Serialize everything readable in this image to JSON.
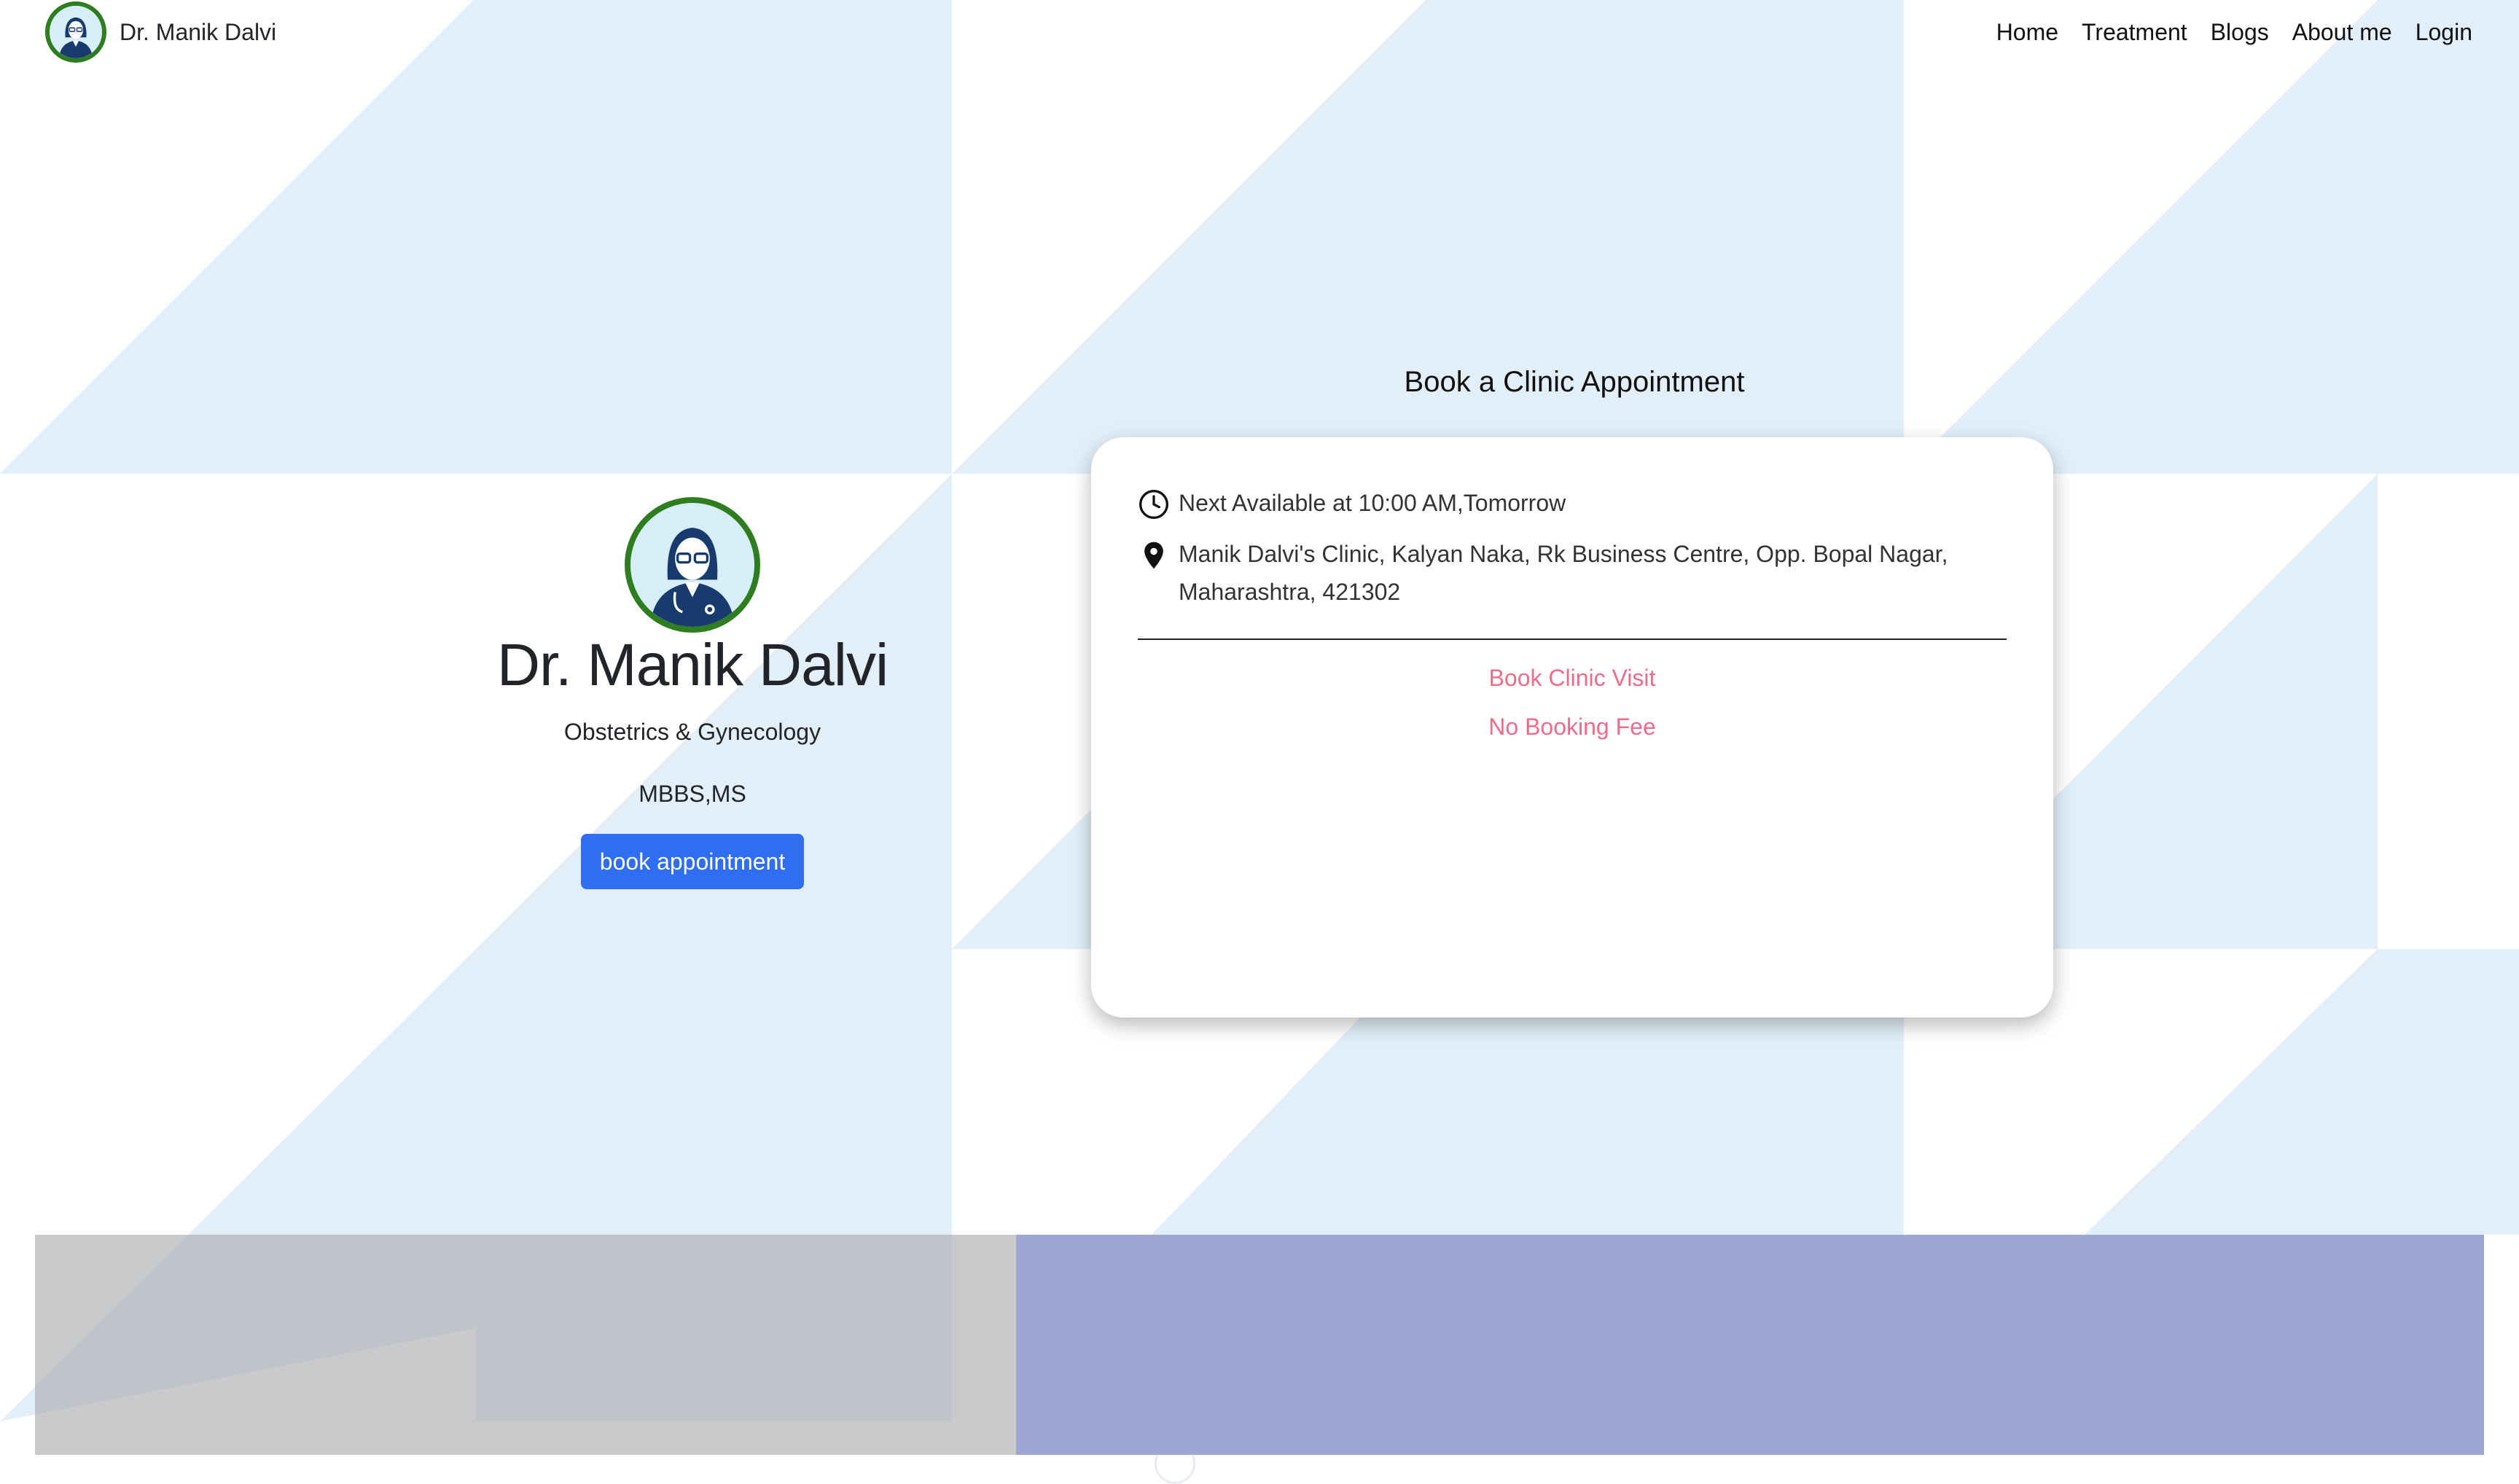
{
  "colors": {
    "bg_triangle": "#e2eff9",
    "avatar_ring": "#2e7d1f",
    "primary_button": "#2f6ef2",
    "pink_link": "#ee6b8a",
    "bottom_purple": "#9ea7d4"
  },
  "navbar": {
    "brand": "Dr. Manik Dalvi",
    "links": [
      "Home",
      "Treatment",
      "Blogs",
      "About me",
      "Login"
    ]
  },
  "profile": {
    "name": "Dr. Manik Dalvi",
    "specialty": "Obstetrics & Gynecology",
    "degree": "MBBS,MS",
    "book_button": "book appointment"
  },
  "appointment": {
    "heading": "Book a Clinic Appointment",
    "next_available": "Next Available at 10:00 AM,Tomorrow",
    "address": "Manik Dalvi's Clinic, Kalyan Naka, Rk Business Centre, Opp. Bopal Nagar, Maharashtra, 421302",
    "book_visit_link": "Book Clinic Visit",
    "fee_note": "No Booking Fee"
  },
  "icons": {
    "clock": "clock-icon",
    "location": "location-pin-icon",
    "avatar": "doctor-avatar-icon"
  }
}
